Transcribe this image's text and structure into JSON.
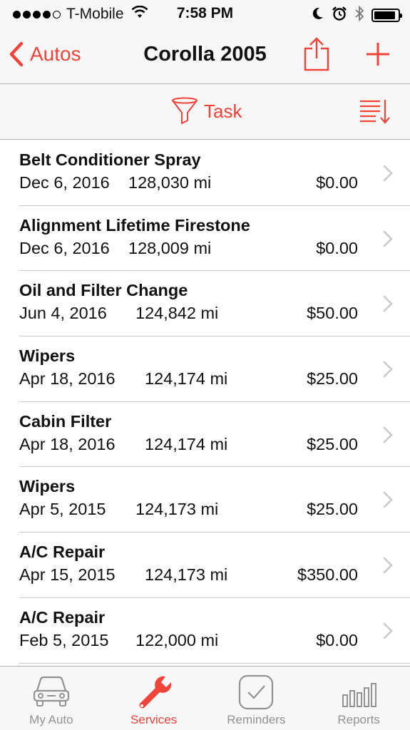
{
  "status_bar": {
    "carrier": "T-Mobile",
    "time": "7:58 PM",
    "signal_bars_filled": 4,
    "signal_bars_total": 5,
    "battery_level": 0.9
  },
  "nav": {
    "back_label": "Autos",
    "title": "Corolla 2005",
    "accent_color": "#f0433a"
  },
  "filter": {
    "label": "Task"
  },
  "services": [
    {
      "title": "Belt Conditioner Spray",
      "date": "Dec 6, 2016",
      "miles": "128,030 mi",
      "cost": "$0.00"
    },
    {
      "title": "Alignment Lifetime Firestone",
      "date": "Dec 6, 2016",
      "miles": "128,009 mi",
      "cost": "$0.00"
    },
    {
      "title": "Oil and Filter Change",
      "date": "Jun 4, 2016",
      "miles": "124,842 mi",
      "cost": "$50.00"
    },
    {
      "title": "Wipers",
      "date": "Apr 18, 2016",
      "miles": "124,174 mi",
      "cost": "$25.00"
    },
    {
      "title": "Cabin Filter",
      "date": "Apr 18, 2016",
      "miles": "124,174 mi",
      "cost": "$25.00"
    },
    {
      "title": "Wipers",
      "date": "Apr 5, 2015",
      "miles": "124,173 mi",
      "cost": "$25.00"
    },
    {
      "title": "A/C Repair",
      "date": "Apr 15, 2015",
      "miles": "124,173 mi",
      "cost": "$350.00"
    },
    {
      "title": "A/C Repair",
      "date": "Feb 5, 2015",
      "miles": "122,000 mi",
      "cost": "$0.00"
    }
  ],
  "tabs": [
    {
      "label": "My Auto",
      "icon": "car-icon",
      "active": false
    },
    {
      "label": "Services",
      "icon": "wrench-icon",
      "active": true
    },
    {
      "label": "Reminders",
      "icon": "checkmark-icon",
      "active": false
    },
    {
      "label": "Reports",
      "icon": "bar-chart-icon",
      "active": false
    }
  ]
}
